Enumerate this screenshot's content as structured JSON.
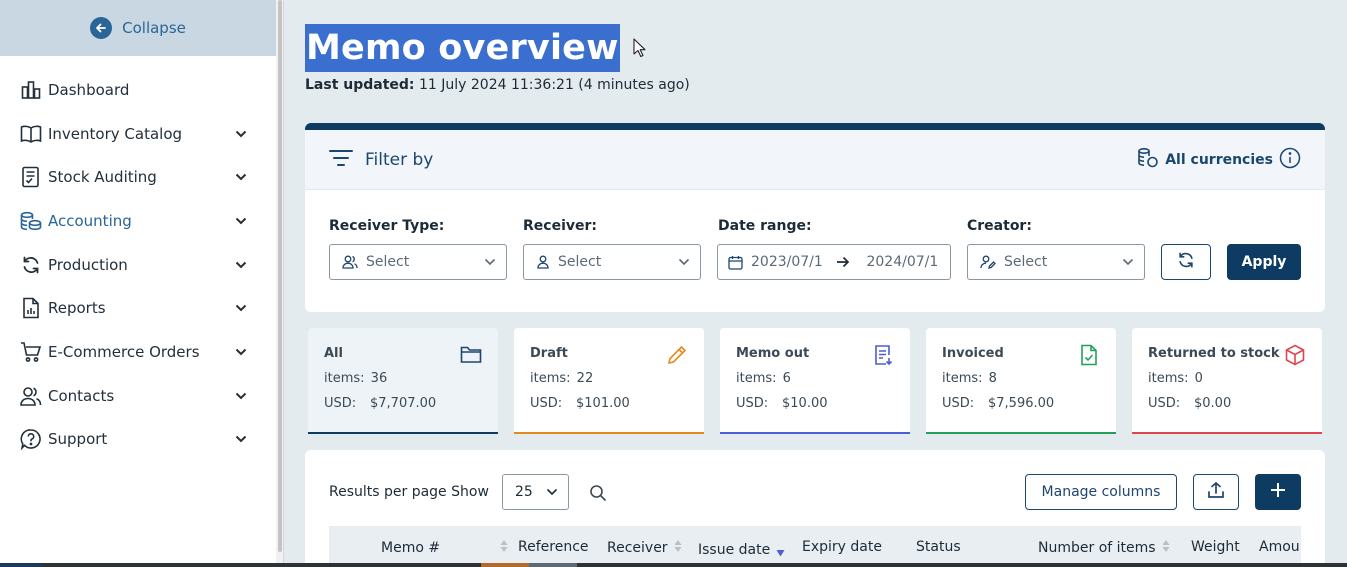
{
  "sidebar": {
    "collapse_label": "Collapse",
    "items": [
      {
        "label": "Dashboard",
        "icon": "dashboard-icon",
        "has_children": false
      },
      {
        "label": "Inventory Catalog",
        "icon": "book-icon",
        "has_children": true
      },
      {
        "label": "Stock Auditing",
        "icon": "clipboard-check-icon",
        "has_children": true
      },
      {
        "label": "Accounting",
        "icon": "coins-icon",
        "has_children": true,
        "active": true
      },
      {
        "label": "Production",
        "icon": "refresh-icon",
        "has_children": true
      },
      {
        "label": "Reports",
        "icon": "report-icon",
        "has_children": true
      },
      {
        "label": "E-Commerce Orders",
        "icon": "cart-icon",
        "has_children": true
      },
      {
        "label": "Contacts",
        "icon": "users-icon",
        "has_children": true
      },
      {
        "label": "Support",
        "icon": "help-icon",
        "has_children": true
      }
    ]
  },
  "header": {
    "title": "Memo overview",
    "last_updated_label": "Last updated:",
    "last_updated_value": "11 July 2024 11:36:21 (4 minutes ago)"
  },
  "filter": {
    "title": "Filter by",
    "currency_label": "All currencies",
    "fields": {
      "receiver_type": {
        "label": "Receiver Type:",
        "value": "Select"
      },
      "receiver": {
        "label": "Receiver:",
        "value": "Select"
      },
      "date_range": {
        "label": "Date range:",
        "from": "2023/07/1",
        "to": "2024/07/1"
      },
      "creator": {
        "label": "Creator:",
        "value": "Select"
      }
    },
    "apply_label": "Apply"
  },
  "cards": [
    {
      "title": "All",
      "items_label": "items:",
      "items": "36",
      "currency": "USD:",
      "amount": "$7,707.00",
      "color": "#0d3b62",
      "icon": "folder-icon",
      "active": true
    },
    {
      "title": "Draft",
      "items_label": "items:",
      "items": "22",
      "currency": "USD:",
      "amount": "$101.00",
      "color": "#e38a1d",
      "icon": "pencil-icon"
    },
    {
      "title": "Memo out",
      "items_label": "items:",
      "items": "6",
      "currency": "USD:",
      "amount": "$10.00",
      "color": "#4b5fd6",
      "icon": "document-download-icon"
    },
    {
      "title": "Invoiced",
      "items_label": "items:",
      "items": "8",
      "currency": "USD:",
      "amount": "$7,596.00",
      "color": "#22a05b",
      "icon": "file-check-icon"
    },
    {
      "title": "Returned to stock",
      "items_label": "items:",
      "items": "0",
      "currency": "USD:",
      "amount": "$0.00",
      "color": "#e0454f",
      "icon": "box-icon"
    }
  ],
  "table": {
    "results_label": "Results per page Show",
    "per_page": "25",
    "manage_columns_label": "Manage columns",
    "columns": [
      "Memo #",
      "Reference",
      "Receiver",
      "Issue date",
      "Expiry date",
      "Status",
      "Number of items",
      "Weight",
      "Amou"
    ]
  }
}
